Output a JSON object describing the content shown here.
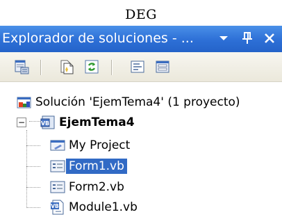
{
  "page_label": "DEG",
  "panel": {
    "title": "Explorador de soluciones - ...",
    "dropdown_icon": "chevron-down-icon",
    "pin_icon": "pin-icon",
    "close_icon": "close-icon"
  },
  "toolbar": {
    "buttons": [
      {
        "icon": "properties-icon"
      },
      {
        "icon": "show-all-files-icon"
      },
      {
        "icon": "refresh-icon"
      },
      {
        "icon": "view-code-icon"
      },
      {
        "icon": "view-designer-icon"
      }
    ]
  },
  "tree": {
    "solution": "Solución 'EjemTema4'  (1 proyecto)",
    "project": "EjemTema4",
    "collapse_glyph": "−",
    "items": [
      {
        "label": "My Project",
        "icon": "my-project-icon"
      },
      {
        "label": "Form1.vb",
        "icon": "form-icon",
        "selected": true
      },
      {
        "label": "Form2.vb",
        "icon": "form-icon"
      },
      {
        "label": "Module1.vb",
        "icon": "vb-module-icon"
      }
    ]
  },
  "colors": {
    "titlebar": "#2d6fd6",
    "selection": "#316ac5"
  }
}
